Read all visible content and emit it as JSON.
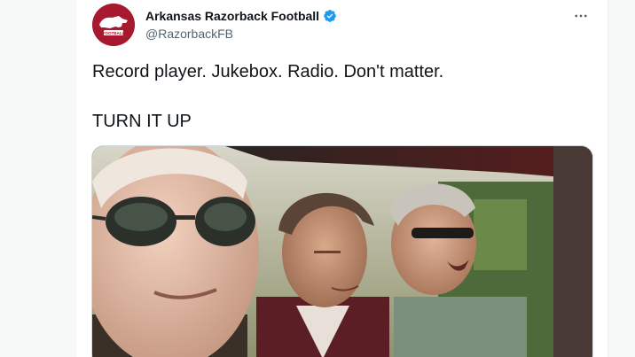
{
  "tweet": {
    "author": {
      "display_name": "Arkansas Razorback Football",
      "handle": "@RazorbackFB",
      "verified": true,
      "avatar_text": "FOOTBALL"
    },
    "text_line1": "Record player. Jukebox. Radio. Don't matter.",
    "text_line2": "TURN IT UP",
    "more_icon": "more-horizontal-icon"
  },
  "colors": {
    "brand": "#a6192e",
    "verified": "#1d9bf0",
    "secondary_text": "#536471"
  }
}
